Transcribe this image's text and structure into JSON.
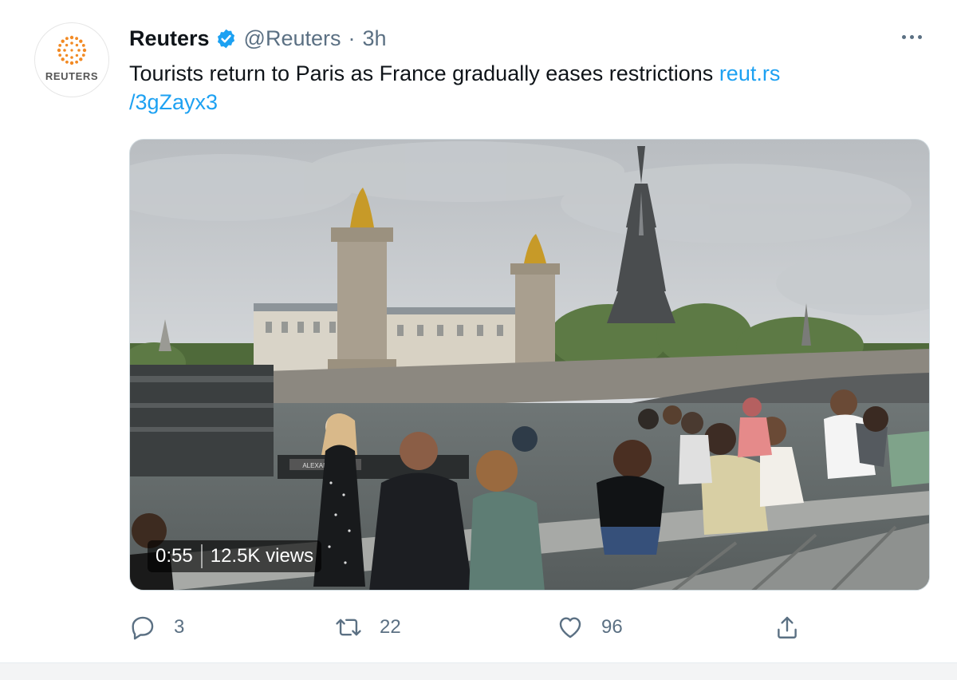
{
  "tweet": {
    "avatar_text": "REUTERS",
    "author_name": "Reuters",
    "handle": "@Reuters",
    "separator": "·",
    "time": "3h",
    "text": "Tourists return to Paris as France gradually eases restrictions ",
    "link_line1": "reut.rs",
    "link_line2": "/3gZayx3"
  },
  "video": {
    "duration": "0:55",
    "views": "12.5K views",
    "sign_text": "ALEXANDRE III"
  },
  "actions": {
    "replies": "3",
    "retweets": "22",
    "likes": "96"
  },
  "colors": {
    "link": "#1da1f2",
    "verified": "#1da1f2",
    "muted": "#5b7083",
    "reuters_orange": "#f28a24"
  }
}
